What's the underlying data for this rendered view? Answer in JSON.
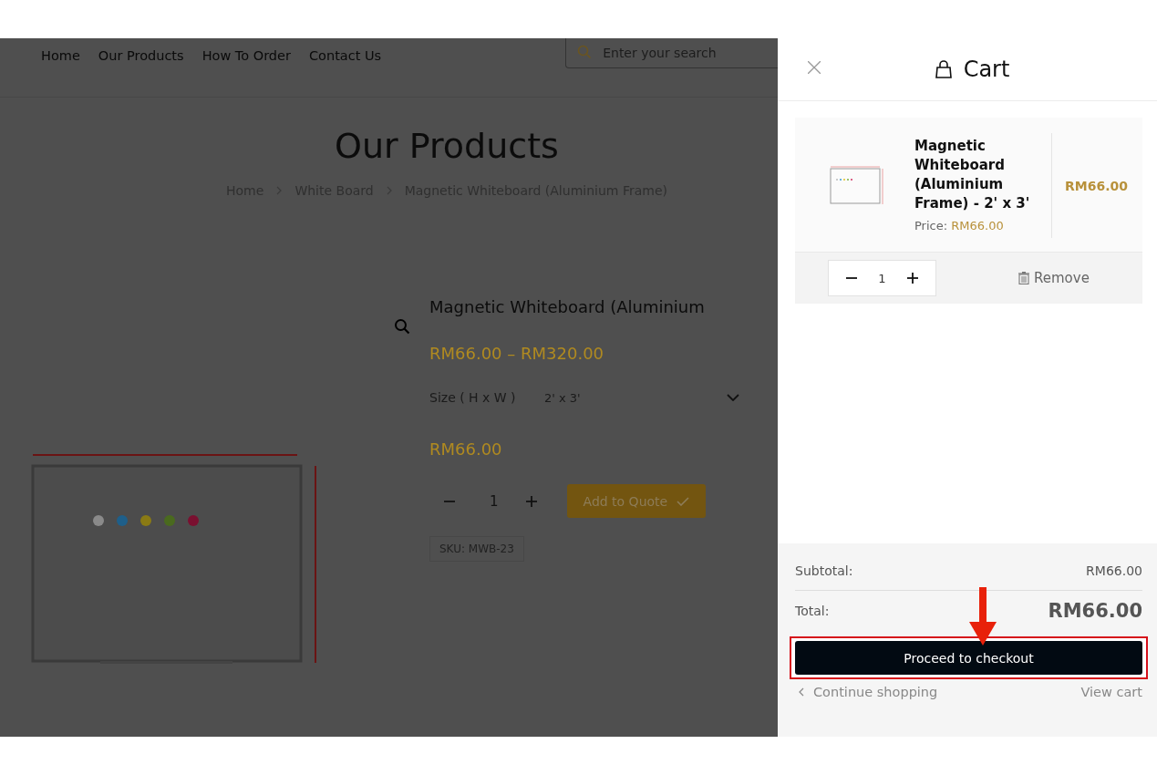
{
  "nav": {
    "items": [
      "Home",
      "Our Products",
      "How To Order",
      "Contact Us"
    ],
    "search_placeholder": "Enter your search"
  },
  "page_title": "Our Products",
  "breadcrumbs": [
    "Home",
    "White Board",
    "Magnetic Whiteboard (Aluminium Frame)"
  ],
  "product": {
    "title": "Magnetic Whiteboard (Aluminium",
    "price_range": "RM66.00 – RM320.00",
    "option": {
      "label": "Size ( H x W )",
      "value": "2' x 3'"
    },
    "price": "RM66.00",
    "quantity": "1",
    "add_button": "Add to Quote",
    "sku": "SKU: MWB-23"
  },
  "cart": {
    "title": "Cart",
    "items": [
      {
        "name": "Magnetic Whiteboard (Aluminium Frame) - 2' x 3'",
        "price_label": "Price:",
        "price": "RM66.00",
        "total": "RM66.00",
        "quantity": "1",
        "remove": "Remove"
      }
    ],
    "subtotal_label": "Subtotal:",
    "subtotal": "RM66.00",
    "total_label": "Total:",
    "total": "RM66.00",
    "checkout_button": "Proceed to checkout",
    "continue_link": "Continue shopping",
    "view_cart_link": "View cart"
  }
}
